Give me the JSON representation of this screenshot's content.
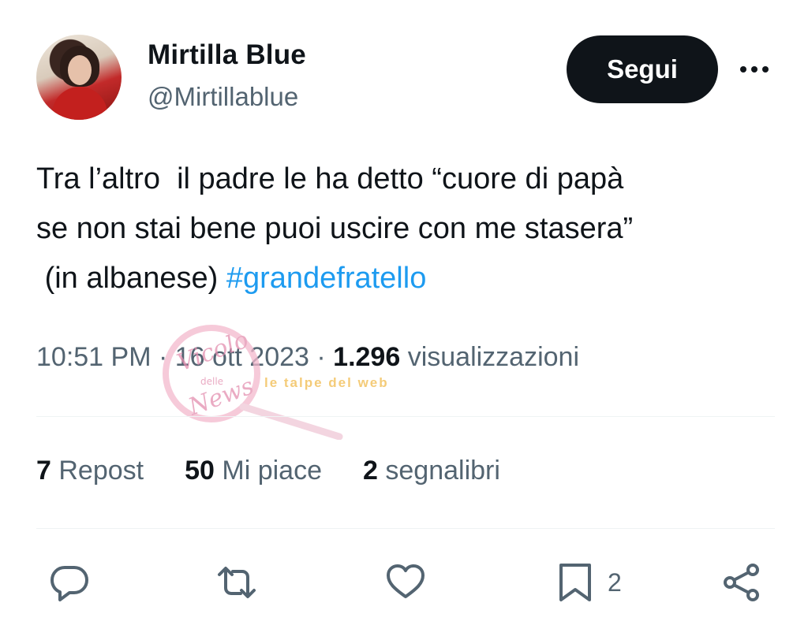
{
  "user": {
    "name": "Mirtilla Blue",
    "handle": "@Mirtillablue"
  },
  "follow_label": "Segui",
  "tweet": {
    "text": "Tra l’altro  il padre le ha detto “cuore di papà\nse non stai bene puoi uscire con me stasera”\n (in albanese) ",
    "hashtag": "#grandefratello"
  },
  "meta": {
    "time": "10:51 PM",
    "date": "16 ott 2023",
    "views_count": "1.296",
    "views_label": "visualizzazioni"
  },
  "stats": {
    "reposts_count": "7",
    "reposts_label": "Repost",
    "likes_count": "50",
    "likes_label": "Mi piace",
    "bookmarks_count": "2",
    "bookmarks_label": "segnalibri"
  },
  "actions": {
    "bookmark_count": "2"
  },
  "watermark": {
    "line1": "Vicolo",
    "line2": "delle",
    "line3": "News",
    "tagline": "le talpe del web"
  },
  "colors": {
    "link": "#1d9bf0",
    "text": "#0f1419",
    "secondary": "#536471",
    "button_bg": "#0f1419"
  }
}
